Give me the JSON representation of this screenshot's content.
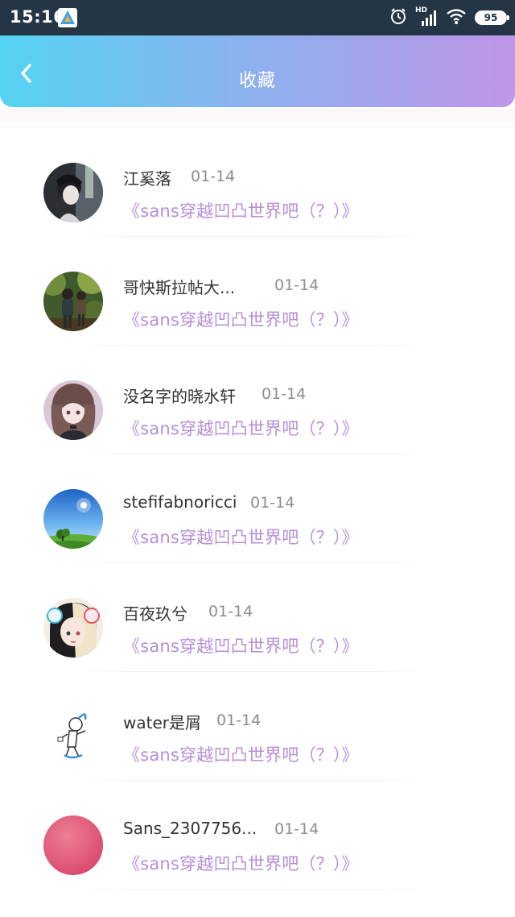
{
  "status_bar": {
    "time": "15:16",
    "network": "HD",
    "battery": "95",
    "icons": [
      "app-indicator-icon",
      "alarm-icon",
      "signal-icon",
      "wifi-icon",
      "battery-icon"
    ]
  },
  "header": {
    "title": "收藏",
    "back_icon": "chevron-left-icon",
    "gradient": [
      "#55d3f3",
      "#8eb0ef",
      "#c095e8"
    ]
  },
  "colors": {
    "title_link": "#b58edc",
    "name": "#333333",
    "date": "#8d8d8d"
  },
  "favorites": [
    {
      "name": "江奚落",
      "date": "01-14",
      "title": "《sans穿越凹凸世界吧（？）》",
      "avatar": "anime-boy-avatar"
    },
    {
      "name": "哥快斯拉帖大...",
      "date": "01-14",
      "title": "《sans穿越凹凸世界吧（？）》",
      "avatar": "forest-hikers-avatar"
    },
    {
      "name": "没名字的晓水轩",
      "date": "01-14",
      "title": "《sans穿越凹凸世界吧（？）》",
      "avatar": "anime-girl-avatar"
    },
    {
      "name": "stefifabnoricci",
      "date": "01-14",
      "title": "《sans穿越凹凸世界吧（？）》",
      "avatar": "sky-landscape-avatar"
    },
    {
      "name": "百夜玖兮",
      "date": "01-14",
      "title": "《sans穿越凹凸世界吧（？）》",
      "avatar": "anime-headphones-avatar"
    },
    {
      "name": "water是屑",
      "date": "01-14",
      "title": "《sans穿越凹凸世界吧（？）》",
      "avatar": "sketch-character-avatar"
    },
    {
      "name": "Sans_2307756...",
      "date": "01-14",
      "title": "《sans穿越凹凸世界吧（？）》",
      "avatar": "pink-circle-avatar"
    }
  ]
}
